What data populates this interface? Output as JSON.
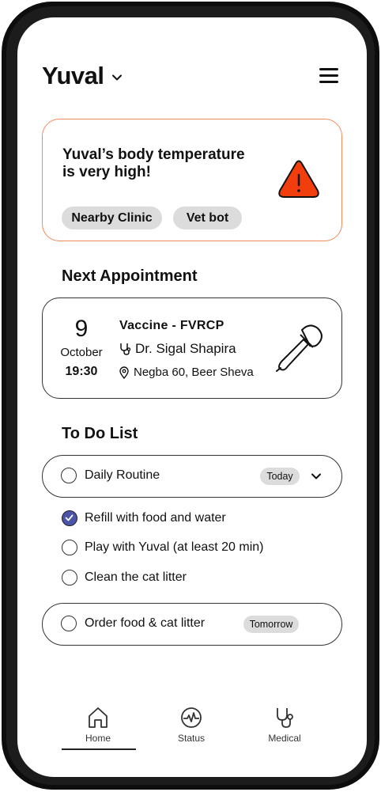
{
  "header": {
    "pet_name": "Yuval"
  },
  "alert": {
    "message": "Yuval’s body temperature is very high!",
    "actions": [
      "Nearby Clinic",
      "Vet bot"
    ]
  },
  "appointment": {
    "section_title": "Next Appointment",
    "day": "9",
    "month": "October",
    "time": "19:30",
    "title": "Vaccine - FVRCP",
    "doctor": "Dr. Sigal Shapira",
    "location": "Negba 60, Beer Sheva"
  },
  "todo": {
    "section_title": "To Do List",
    "routine": {
      "label": "Daily Routine",
      "badge": "Today"
    },
    "subtasks": [
      {
        "label": "Refill with food and water",
        "checked": true
      },
      {
        "label": "Play with Yuval (at least 20 min)",
        "checked": false
      },
      {
        "label": "Clean the cat litter",
        "checked": false
      }
    ],
    "next": {
      "label": "Order food & cat litter",
      "badge": "Tomorrow"
    }
  },
  "nav": {
    "items": [
      "Home",
      "Status",
      "Medical"
    ],
    "active": "Home"
  },
  "colors": {
    "alert_border": "#f08b5e",
    "warning_fill": "#f23d0c",
    "checked_fill": "#4b54a8"
  }
}
